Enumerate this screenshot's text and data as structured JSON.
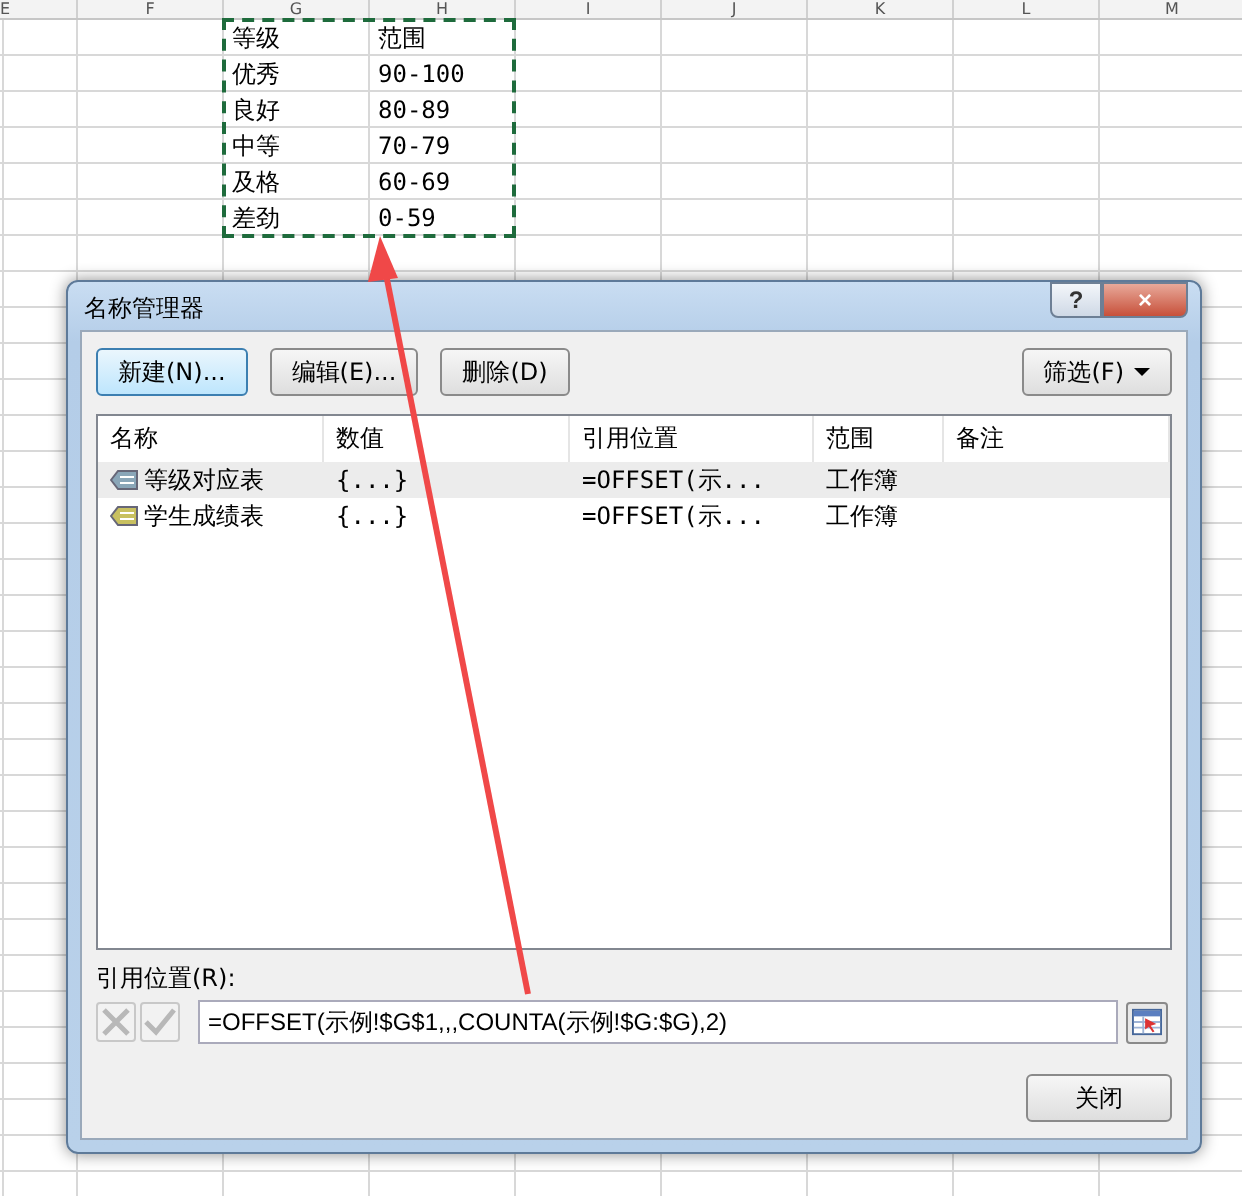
{
  "sheet": {
    "columns": [
      "E",
      "F",
      "G",
      "H",
      "I",
      "J",
      "K",
      "L",
      "M"
    ],
    "rows": [
      [
        "等级",
        "范围"
      ],
      [
        "优秀",
        "90-100"
      ],
      [
        "良好",
        "80-89"
      ],
      [
        "中等",
        "70-79"
      ],
      [
        "及格",
        "60-69"
      ],
      [
        "差劲",
        "0-59"
      ]
    ]
  },
  "dialog": {
    "title": "名称管理器",
    "help": "?",
    "close": "×",
    "buttons": [
      {
        "label": "新建(N)...",
        "focused": true
      },
      {
        "label": "编辑(E)...",
        "focused": false
      },
      {
        "label": "删除(D)",
        "focused": false
      }
    ],
    "filter": {
      "label": "筛选(F)"
    },
    "list": {
      "columns": [
        "名称",
        "数值",
        "引用位置",
        "范围",
        "备注"
      ],
      "rows": [
        {
          "name": "等级对应表",
          "value": "{...}",
          "refers_to": "=OFFSET(示...",
          "scope": "工作簿",
          "color": "#8aa6b8",
          "selected": true
        },
        {
          "name": "学生成绩表",
          "value": "{...}",
          "refers_to": "=OFFSET(示...",
          "scope": "工作簿",
          "color": "#c8c060",
          "selected": false
        }
      ]
    },
    "refers_label": "引用位置(R):",
    "refers_value": "=OFFSET(示例!$G$1,,,COUNTA(示例!$G:$G),2)",
    "close_button": "关闭"
  }
}
